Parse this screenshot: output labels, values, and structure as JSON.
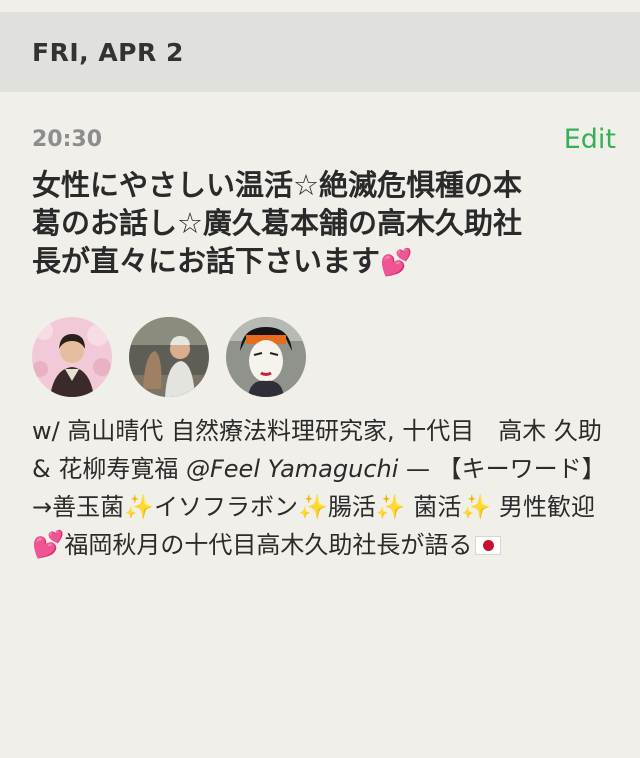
{
  "date_header": "FRI, APR 2",
  "event": {
    "time": "20:30",
    "edit_label": "Edit",
    "title": "女性にやさしい温活☆絶滅危惧種の本葛のお話し☆廣久葛本舗の高木久助社長が直々にお話下さいます",
    "title_emoji": "💕",
    "hosts_prefix": "w/ ",
    "hosts": "高山晴代 自然療法料理研究家, 十代目　高木 久助 & 花柳寿寛福",
    "place": "@Feel Yamaguchi",
    "separator": " — ",
    "keyword_intro": "【キーワード】→善玉菌",
    "kw_sparkle_1": "✨",
    "kw_2": "イソフラボン",
    "kw_sparkle_2": "✨",
    "kw_3": "腸活",
    "kw_sparkle_3": "✨",
    "kw_4": "菌活",
    "kw_sparkle_4": "✨",
    "kw_5": "男性歓迎",
    "kw_heart": "💕",
    "kw_6": "福岡秋月の十代目高木久助社長が語る",
    "flag_icon": "japan-flag-icon"
  },
  "colors": {
    "background": "#f1efe9",
    "header_band": "#e0e1dc",
    "edit_accent": "#35b05a",
    "time_gray": "#8d8d8d"
  }
}
